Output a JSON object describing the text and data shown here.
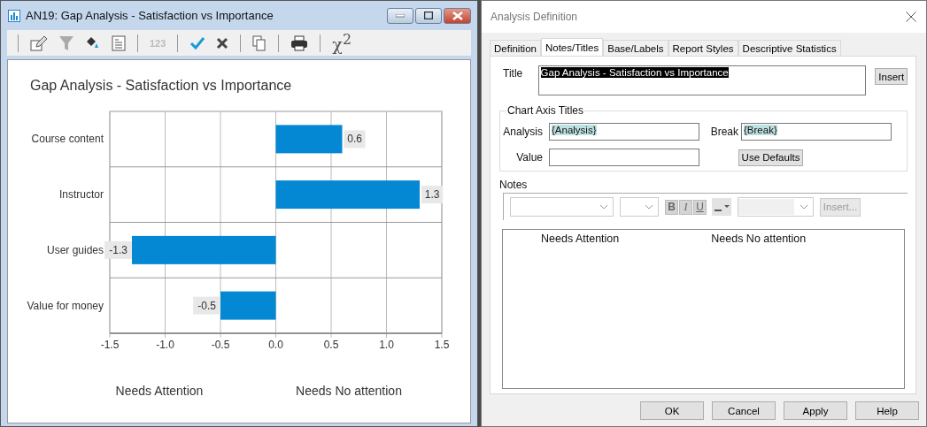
{
  "chart_window": {
    "title": "AN19: Gap Analysis - Satisfaction vs Importance",
    "toolbar": [
      [
        {
          "kind": "edit"
        },
        {
          "kind": "filter",
          "disabled": true
        },
        {
          "kind": "fill"
        },
        {
          "kind": "report"
        }
      ],
      [
        {
          "kind": "numbers",
          "label": "123",
          "disabled": true
        }
      ],
      [
        {
          "kind": "check"
        },
        {
          "kind": "cross"
        }
      ],
      [
        {
          "kind": "copy"
        }
      ],
      [
        {
          "kind": "print"
        }
      ],
      [
        {
          "kind": "chi",
          "label": "χ$^{2}$"
        }
      ]
    ],
    "chart_data": {
      "type": "bar",
      "orientation": "horizontal",
      "grid": true,
      "title": "Gap Analysis - Satisfaction vs Importance",
      "categories": [
        "Course content",
        "Instructor",
        "User guides",
        "Value for money"
      ],
      "series": [
        {
          "color": "#0588d4",
          "values": [
            0.6,
            1.3,
            -1.3,
            -0.5
          ]
        }
      ],
      "value_labels": [
        "0.6",
        "1.3",
        "-1.3",
        "-0.5"
      ],
      "xlim": [
        -1.5,
        1.5
      ],
      "xticks": [
        {
          "value": -1.5,
          "label": "-1.5"
        },
        {
          "value": -1,
          "label": "-1.0"
        },
        {
          "value": -0.5,
          "label": "-0.5"
        },
        {
          "value": 0,
          "label": "0.0"
        },
        {
          "value": 0.5,
          "label": "0.5"
        },
        {
          "value": 1,
          "label": "1.0"
        },
        {
          "value": 1.5,
          "label": "1.5"
        }
      ],
      "annotations": [
        "Needs Attention",
        "Needs No attention"
      ]
    }
  },
  "dialog": {
    "title": "Analysis Definition",
    "tabs": [
      {
        "label": "Definition",
        "selected": false
      },
      {
        "label": "Notes/Titles",
        "selected": true
      },
      {
        "label": "Base/Labels",
        "selected": false
      },
      {
        "label": "Report Styles",
        "selected": false
      },
      {
        "label": "Descriptive Statistics",
        "selected": false
      }
    ],
    "title_field": {
      "label": "Title",
      "value": "Gap Analysis - Satisfaction vs Importance",
      "highlighted": true
    },
    "insert_button": "Insert",
    "axis_titles": {
      "legend": "Chart Axis Titles",
      "analysis": {
        "label": "Analysis",
        "value": "{Analysis}",
        "highlighted": true
      },
      "break": {
        "label": "Break",
        "value": "{Break}",
        "highlighted": true
      },
      "value": {
        "label": "Value",
        "highlighted": false
      },
      "defaults_button": "Use Defaults"
    },
    "notes": {
      "label": "Notes",
      "format_buttons": [
        {
          "kind": "bold",
          "label": "B",
          "disabled": true
        },
        {
          "kind": "italic",
          "label": "I",
          "disabled": true
        },
        {
          "kind": "underline",
          "label": "U",
          "disabled": true
        }
      ],
      "insert_button": {
        "label": "Insert...",
        "disabled": true
      },
      "text": [
        "Needs Attention",
        "Needs No attention"
      ]
    },
    "buttons": [
      "OK",
      "Cancel",
      "Apply",
      "Help"
    ]
  }
}
